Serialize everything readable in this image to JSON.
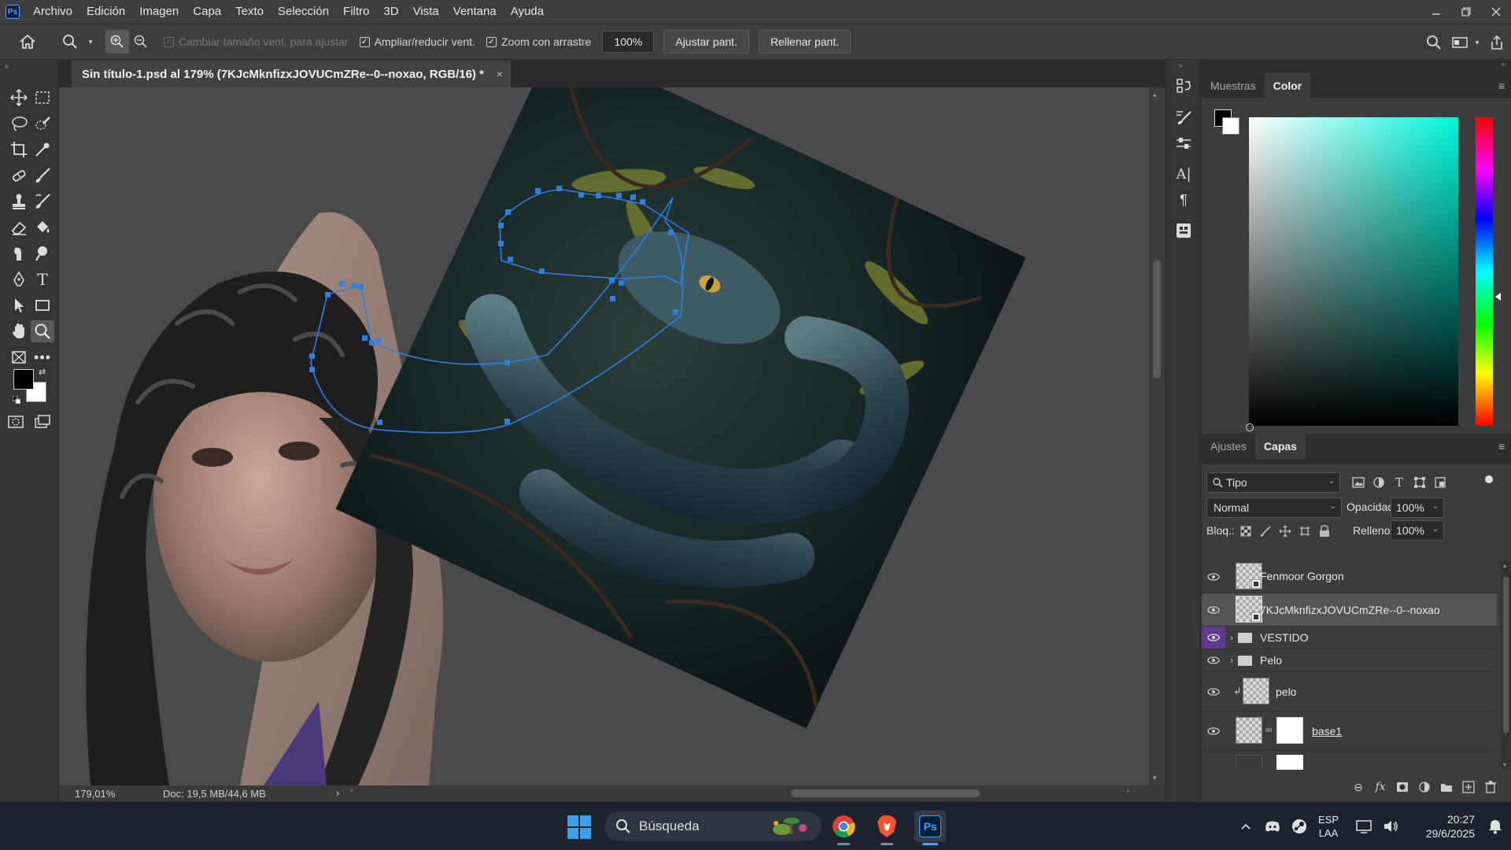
{
  "app": {
    "logo": "Ps"
  },
  "menu": [
    "Archivo",
    "Edición",
    "Imagen",
    "Capa",
    "Texto",
    "Selección",
    "Filtro",
    "3D",
    "Vista",
    "Ventana",
    "Ayuda"
  ],
  "options": {
    "resize_windows_label": "Cambiar tamaño vent. para ajustar",
    "resize_windows_checked": true,
    "zoom_all_label": "Ampliar/reducir vent.",
    "zoom_all_checked": true,
    "scrubby_zoom_label": "Zoom con arrastre",
    "scrubby_zoom_checked": true,
    "zoom_value": "100%",
    "fit_screen_label": "Ajustar pant.",
    "fill_screen_label": "Rellenar pant."
  },
  "document": {
    "tab_title": "Sin título-1.psd al 179% (7KJcMknfizxJOVUCmZRe--0--noxao, RGB/16) *",
    "close_glyph": "×"
  },
  "status": {
    "zoom": "179,01%",
    "doc_info": "Doc: 19,5 MB/44,6 MB",
    "more_glyph": "›"
  },
  "colors": {
    "foreground": "#000000",
    "background": "#ffffff",
    "picker_hue": "#00f6d9",
    "selection_path": "#2f7fe0",
    "active_eye": "#5d3d8e"
  },
  "panels": {
    "top_tabs": [
      "Muestras",
      "Color"
    ],
    "top_active": "Color",
    "bottom_tabs": [
      "Ajustes",
      "Capas"
    ],
    "bottom_active": "Capas"
  },
  "layers_panel": {
    "filter_label": "Tipo",
    "blend_mode": "Normal",
    "opacity_label": "Opacidad:",
    "opacity_value": "100%",
    "lock_label": "Bloq.:",
    "fill_label": "Relleno:",
    "fill_value": "100%",
    "layers": [
      {
        "name": "Fenmoor Gorgon",
        "kind": "smart",
        "selected": false,
        "eye_highlight": false
      },
      {
        "name": "7KJcMknfizxJOVUCmZRe--0--noxao",
        "kind": "smart",
        "selected": true,
        "eye_highlight": false
      },
      {
        "name": "VESTIDO",
        "kind": "group",
        "selected": false,
        "eye_highlight": true
      },
      {
        "name": "Pelo",
        "kind": "group",
        "selected": false,
        "eye_highlight": false
      },
      {
        "name": "pelo",
        "kind": "clipped",
        "selected": false,
        "eye_highlight": false
      },
      {
        "name": "base1",
        "kind": "masked",
        "selected": false,
        "eye_highlight": false
      }
    ]
  },
  "taskbar": {
    "search_placeholder": "Búsqueda",
    "language_1": "ESP",
    "language_2": "LAA",
    "time": "20:27",
    "date": "29/6/2025"
  }
}
